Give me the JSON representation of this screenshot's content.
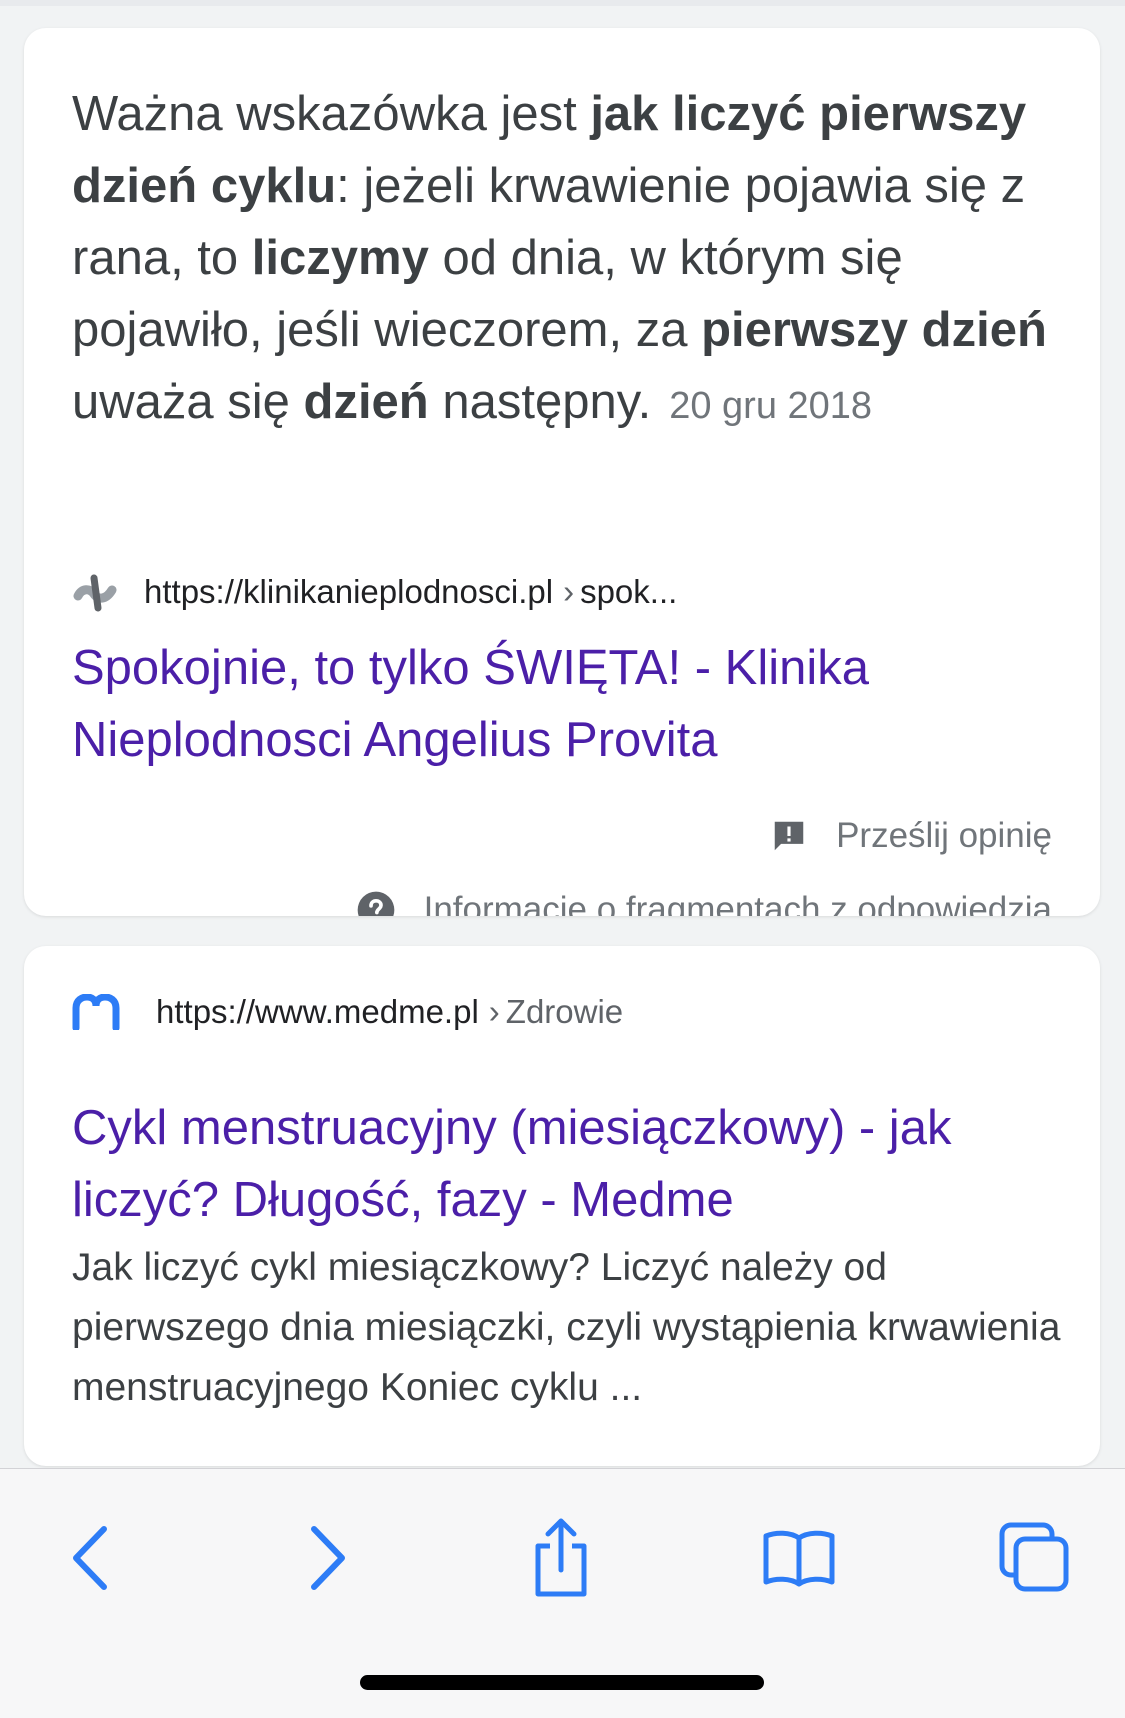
{
  "result1": {
    "snippet": {
      "t1": "Ważna wskazówka jest ",
      "b1": "jak liczyć pierwszy dzień cyklu",
      "t2": ": jeżeli krwawienie pojawia się z rana, to ",
      "b2": "liczymy",
      "t3": " od dnia, w którym się pojawiło, jeśli wieczorem, za ",
      "b3": "pierwszy dzień",
      "t4": " uważa się ",
      "b4": "dzień",
      "t5": " następny.",
      "date": "20 gru 2018"
    },
    "source": {
      "url": "https://klinikanieplodnosci.pl",
      "separator": "›",
      "path": "spok..."
    },
    "title": "Spokojnie, to tylko ŚWIĘTA! - Klinika Nieplodnosci Angelius Provita",
    "feedback_label": "Prześlij opinię",
    "about_label": "Informacje o fragmentach z odpowiedzią"
  },
  "result2": {
    "source": {
      "url": "https://www.medme.pl",
      "separator": "›",
      "path": "Zdrowie"
    },
    "title": "Cykl menstruacyjny (miesiączkowy) - jak liczyć? Długość, fazy - Medme",
    "description": "Jak liczyć cykl miesiączkowy? Liczyć należy od pierwszego dnia miesiączki, czyli wystąpienia krwawienia menstruacyjnego Koniec cyklu ..."
  },
  "toolbar": {
    "icons": [
      "back-icon",
      "forward-icon",
      "share-icon",
      "bookmarks-icon",
      "tabs-icon"
    ]
  },
  "colors": {
    "link": "#4b1fa8",
    "accent": "#2d7cf6",
    "text": "#3c4043",
    "muted": "#70757a"
  }
}
